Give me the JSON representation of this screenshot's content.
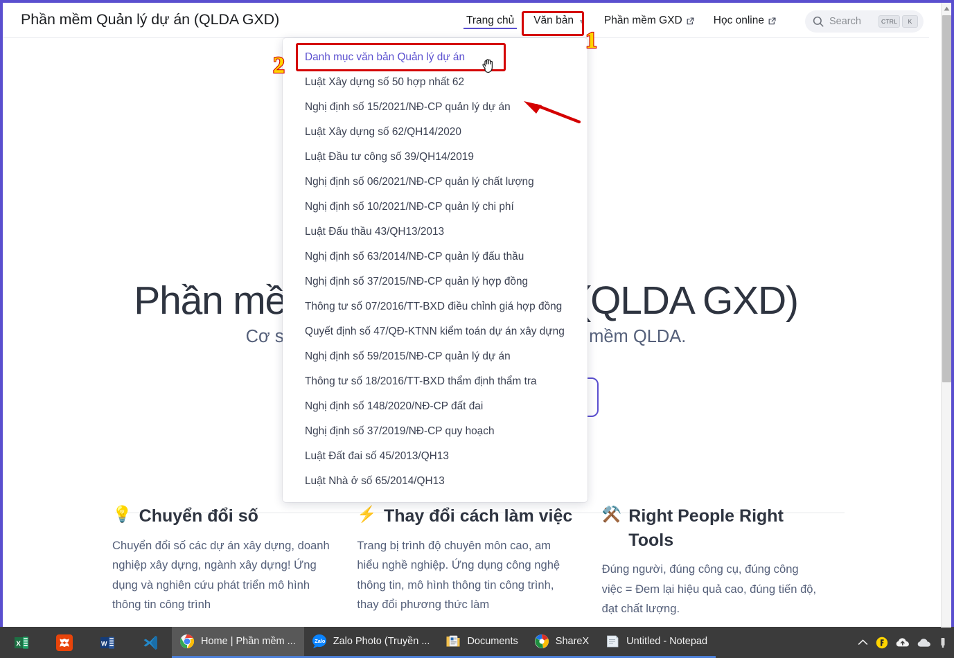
{
  "header": {
    "brand": "Phần mềm Quản lý dự án (QLDA GXD)",
    "nav": [
      {
        "label": "Trang chủ",
        "active": true,
        "caret": false,
        "external": false,
        "name": "nav-trang-chu"
      },
      {
        "label": "Văn bản",
        "active": false,
        "caret": true,
        "external": false,
        "name": "nav-van-ban"
      },
      {
        "label": "Phần mềm GXD",
        "active": false,
        "caret": false,
        "external": true,
        "name": "nav-phan-mem-gxd"
      },
      {
        "label": "Học online",
        "active": false,
        "caret": false,
        "external": true,
        "name": "nav-hoc-online"
      }
    ],
    "search": {
      "placeholder": "Search",
      "kbd_modifier": "CTRL",
      "kbd_key": "K",
      "icon": "search-icon"
    }
  },
  "dropdown": {
    "open": true,
    "items": [
      "Danh mục văn bản Quản lý dự án",
      "Luật Xây dựng số 50 hợp nhất 62",
      "Nghị định số 15/2021/NĐ-CP quản lý dự án",
      "Luật Xây dựng số 62/QH14/2020",
      "Luật Đầu tư công số 39/QH14/2019",
      "Nghị định số 06/2021/NĐ-CP quản lý chất lượng",
      "Nghị định số 10/2021/NĐ-CP quản lý chi phí",
      "Luật Đấu thầu 43/QH13/2013",
      "Nghị định số 63/2014/NĐ-CP quản lý đấu thầu",
      "Nghị định số 37/2015/NĐ-CP quản lý hợp đồng",
      "Thông tư số 07/2016/TT-BXD điều chỉnh giá hợp đồng",
      "Quyết định số 47/QĐ-KTNN kiểm toán dự án xây dựng",
      "Nghị định số 59/2015/NĐ-CP quản lý dự án",
      "Thông tư số 18/2016/TT-BXD thẩm định thẩm tra",
      "Nghị định số 148/2020/NĐ-CP đất đai",
      "Nghị định số 37/2019/NĐ-CP quy hoạch",
      "Luật Đất đai số 45/2013/QH13",
      "Luật Nhà ở số 65/2014/QH13"
    ]
  },
  "hero": {
    "title": "Phần mềm Quản lý dự án (QLDA GXD)",
    "subtitle": "Cơ sở dữ liệu và hướng dẫn sử dụng phần mềm QLDA."
  },
  "features": [
    {
      "emoji": "💡",
      "icon": "lightbulb-icon",
      "title": "Chuyển đổi số",
      "body": "Chuyển đổi số các dự án xây dựng, doanh nghiệp xây dựng, ngành xây dựng! Ứng dụng và nghiên cứu phát triển mô hình thông tin công trình"
    },
    {
      "emoji": "⚡",
      "icon": "lightning-icon",
      "title": "Thay đổi cách làm việc",
      "body": "Trang bị trình độ chuyên môn cao, am hiểu nghề nghiệp. Ứng dụng công nghệ thông tin, mô hình thông tin công trình, thay đổi phương thức làm"
    },
    {
      "emoji": "⚒️",
      "icon": "tools-icon",
      "title": "Right People Right Tools",
      "body": "Đúng người, đúng công cụ, đúng công việc = Đem lại hiệu quả cao, đúng tiến độ, đạt chất lượng."
    }
  ],
  "annotations": {
    "marker_1": "1",
    "marker_2": "2",
    "arrow_color": "#d40000",
    "box_color": "#d40000",
    "number_fill": "#ffd400"
  },
  "taskbar": {
    "pinned": [
      {
        "name": "taskbar-excel-icon",
        "label": "Excel"
      },
      {
        "name": "taskbar-bluebeam-icon",
        "label": "Bluebeam"
      },
      {
        "name": "taskbar-word-icon",
        "label": "Word"
      },
      {
        "name": "taskbar-vscode-icon",
        "label": "Visual Studio Code"
      }
    ],
    "windows": [
      {
        "name": "taskbar-window-chrome",
        "icon": "chrome-icon",
        "label": "Home | Phần mềm ...",
        "active": true
      },
      {
        "name": "taskbar-window-zalo",
        "icon": "zalo-icon",
        "label": "Zalo Photo (Truyền ...",
        "active": false
      },
      {
        "name": "taskbar-window-documents",
        "icon": "folder-icon",
        "label": "Documents",
        "active": false
      },
      {
        "name": "taskbar-window-sharex",
        "icon": "sharex-icon",
        "label": "ShareX",
        "active": false
      },
      {
        "name": "taskbar-window-notepad",
        "icon": "notepad-icon",
        "label": "Untitled - Notepad",
        "active": false
      }
    ],
    "tray": [
      {
        "name": "tray-show-hidden-icons",
        "glyph": "chevron-up-icon"
      },
      {
        "name": "tray-lastpass-icon",
        "glyph": "lastpass-icon"
      },
      {
        "name": "tray-onedrive-upload-icon",
        "glyph": "cloud-up-icon"
      },
      {
        "name": "tray-cloud-icon",
        "glyph": "cloud-icon"
      },
      {
        "name": "tray-more-icon",
        "glyph": "misc-icon"
      }
    ]
  },
  "scrollbar": {
    "name": "page-scrollbar",
    "thumb_top_pct": 2,
    "thumb_height_pct": 59
  },
  "colors": {
    "accent": "#5a4fcf",
    "text": "#2e3440",
    "muted": "#55607a",
    "annotation_red": "#d40000",
    "annotation_yellow": "#ffd400",
    "taskbar_bg": "#3b3b3b"
  }
}
